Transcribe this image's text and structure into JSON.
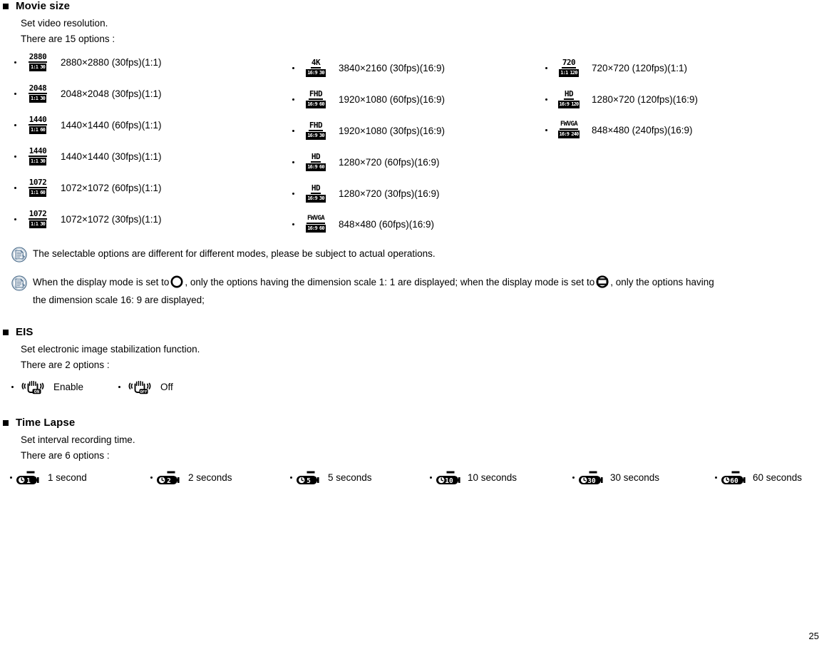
{
  "page": {
    "number": "25"
  },
  "sections": {
    "movie_size": {
      "title": "Movie size",
      "description": "Set video resolution.",
      "options_count_text": "There are 15 options :",
      "columns": [
        {
          "items": [
            {
              "icon_big": "2880",
              "icon_ratio": "1:1",
              "icon_fps": "30",
              "label": "2880×2880 (30fps)(1:1)"
            },
            {
              "icon_big": "2048",
              "icon_ratio": "1:1",
              "icon_fps": "30",
              "label": "2048×2048 (30fps)(1:1)"
            },
            {
              "icon_big": "1440",
              "icon_ratio": "1:1",
              "icon_fps": "60",
              "label": "1440×1440 (60fps)(1:1)"
            },
            {
              "icon_big": "1440",
              "icon_ratio": "1:1",
              "icon_fps": "30",
              "label": "1440×1440 (30fps)(1:1)"
            },
            {
              "icon_big": "1072",
              "icon_ratio": "1:1",
              "icon_fps": "60",
              "label": "1072×1072 (60fps)(1:1)"
            },
            {
              "icon_big": "1072",
              "icon_ratio": "1:1",
              "icon_fps": "30",
              "label": "1072×1072 (30fps)(1:1)"
            }
          ]
        },
        {
          "items": [
            {
              "icon_big": "4K",
              "icon_ratio": "16:9",
              "icon_fps": "30",
              "label": "3840×2160 (30fps)(16:9)"
            },
            {
              "icon_big": "FHD",
              "icon_ratio": "16:9",
              "icon_fps": "60",
              "label": "1920×1080 (60fps)(16:9)"
            },
            {
              "icon_big": "FHD",
              "icon_ratio": "16:9",
              "icon_fps": "30",
              "label": "1920×1080 (30fps)(16:9)"
            },
            {
              "icon_big": "HD",
              "icon_ratio": "16:9",
              "icon_fps": "60",
              "label": "1280×720 (60fps)(16:9)"
            },
            {
              "icon_big": "HD",
              "icon_ratio": "16:9",
              "icon_fps": "30",
              "label": "1280×720 (30fps)(16:9)"
            },
            {
              "icon_big": "FWVGA",
              "icon_ratio": "16:9",
              "icon_fps": "60",
              "label": "848×480 (60fps)(16:9)"
            }
          ]
        },
        {
          "items": [
            {
              "icon_big": "720",
              "icon_ratio": "1:1",
              "icon_fps": "120",
              "label": "720×720 (120fps)(1:1)"
            },
            {
              "icon_big": "HD",
              "icon_ratio": "16:9",
              "icon_fps": "120",
              "label": "1280×720 (120fps)(16:9)"
            },
            {
              "icon_big": "FWVGA",
              "icon_ratio": "16:9",
              "icon_fps": "240",
              "label": "848×480 (240fps)(16:9)"
            }
          ]
        }
      ],
      "notes": [
        {
          "text": "The selectable options are different for different modes, please be subject to actual operations."
        },
        {
          "part1": "When the display mode is set to",
          "glyph1": "circle-display-mode-icon",
          "part2": ", only the options having the dimension scale 1: 1 are displayed; when the display mode is set to",
          "glyph2": "rectangle-display-mode-icon",
          "part3": ", only the options having",
          "part4": "the dimension scale 16: 9 are displayed;"
        }
      ]
    },
    "eis": {
      "title": "EIS",
      "description": "Set electronic image stabilization function.",
      "options_count_text": "There are 2 options :",
      "options": [
        {
          "badge": "ON",
          "label": "Enable"
        },
        {
          "badge": "OFF",
          "label": "Off"
        }
      ]
    },
    "time_lapse": {
      "title": "Time Lapse",
      "description": "Set interval recording time.",
      "options_count_text": "There are 6 options :",
      "options": [
        {
          "value": "1",
          "label": "1 second"
        },
        {
          "value": "2",
          "label": "2 seconds"
        },
        {
          "value": "5",
          "label": "5 seconds"
        },
        {
          "value": "10",
          "label": "10 seconds"
        },
        {
          "value": "30",
          "label": "30 seconds"
        },
        {
          "value": "60",
          "label": "60 seconds"
        }
      ]
    }
  },
  "colors": {
    "ink": "#000000",
    "note_icon_border": "#4a6b8a",
    "note_icon_fill": "#e8eef5",
    "background": "#ffffff"
  }
}
